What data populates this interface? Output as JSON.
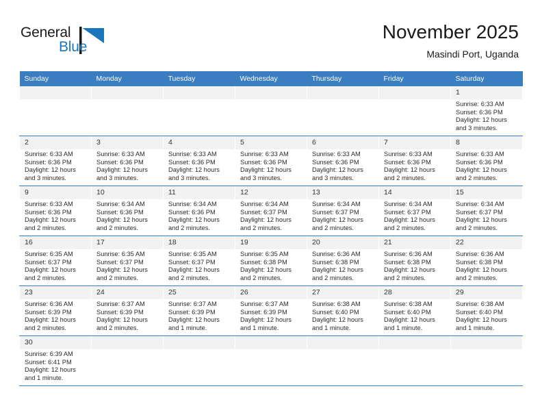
{
  "brand": {
    "name_part1": "General",
    "name_part2": "Blue",
    "logo_icon": "flag-triangle-icon",
    "color_blue": "#1b75bb",
    "color_black": "#1a1a1a"
  },
  "header": {
    "title": "November 2025",
    "subtitle": "Masindi Port, Uganda"
  },
  "theme": {
    "header_bg": "#3a7dc0",
    "daynum_bg": "#f2f2f2",
    "grid_line": "#3a7dc0"
  },
  "calendar": {
    "weekday_headers": [
      "Sunday",
      "Monday",
      "Tuesday",
      "Wednesday",
      "Thursday",
      "Friday",
      "Saturday"
    ],
    "weeks": [
      [
        {
          "empty": true
        },
        {
          "empty": true
        },
        {
          "empty": true
        },
        {
          "empty": true
        },
        {
          "empty": true
        },
        {
          "empty": true
        },
        {
          "day": "1",
          "sunrise": "Sunrise: 6:33 AM",
          "sunset": "Sunset: 6:36 PM",
          "daylight1": "Daylight: 12 hours",
          "daylight2": "and 3 minutes."
        }
      ],
      [
        {
          "day": "2",
          "sunrise": "Sunrise: 6:33 AM",
          "sunset": "Sunset: 6:36 PM",
          "daylight1": "Daylight: 12 hours",
          "daylight2": "and 3 minutes."
        },
        {
          "day": "3",
          "sunrise": "Sunrise: 6:33 AM",
          "sunset": "Sunset: 6:36 PM",
          "daylight1": "Daylight: 12 hours",
          "daylight2": "and 3 minutes."
        },
        {
          "day": "4",
          "sunrise": "Sunrise: 6:33 AM",
          "sunset": "Sunset: 6:36 PM",
          "daylight1": "Daylight: 12 hours",
          "daylight2": "and 3 minutes."
        },
        {
          "day": "5",
          "sunrise": "Sunrise: 6:33 AM",
          "sunset": "Sunset: 6:36 PM",
          "daylight1": "Daylight: 12 hours",
          "daylight2": "and 3 minutes."
        },
        {
          "day": "6",
          "sunrise": "Sunrise: 6:33 AM",
          "sunset": "Sunset: 6:36 PM",
          "daylight1": "Daylight: 12 hours",
          "daylight2": "and 3 minutes."
        },
        {
          "day": "7",
          "sunrise": "Sunrise: 6:33 AM",
          "sunset": "Sunset: 6:36 PM",
          "daylight1": "Daylight: 12 hours",
          "daylight2": "and 2 minutes."
        },
        {
          "day": "8",
          "sunrise": "Sunrise: 6:33 AM",
          "sunset": "Sunset: 6:36 PM",
          "daylight1": "Daylight: 12 hours",
          "daylight2": "and 2 minutes."
        }
      ],
      [
        {
          "day": "9",
          "sunrise": "Sunrise: 6:33 AM",
          "sunset": "Sunset: 6:36 PM",
          "daylight1": "Daylight: 12 hours",
          "daylight2": "and 2 minutes."
        },
        {
          "day": "10",
          "sunrise": "Sunrise: 6:34 AM",
          "sunset": "Sunset: 6:36 PM",
          "daylight1": "Daylight: 12 hours",
          "daylight2": "and 2 minutes."
        },
        {
          "day": "11",
          "sunrise": "Sunrise: 6:34 AM",
          "sunset": "Sunset: 6:36 PM",
          "daylight1": "Daylight: 12 hours",
          "daylight2": "and 2 minutes."
        },
        {
          "day": "12",
          "sunrise": "Sunrise: 6:34 AM",
          "sunset": "Sunset: 6:37 PM",
          "daylight1": "Daylight: 12 hours",
          "daylight2": "and 2 minutes."
        },
        {
          "day": "13",
          "sunrise": "Sunrise: 6:34 AM",
          "sunset": "Sunset: 6:37 PM",
          "daylight1": "Daylight: 12 hours",
          "daylight2": "and 2 minutes."
        },
        {
          "day": "14",
          "sunrise": "Sunrise: 6:34 AM",
          "sunset": "Sunset: 6:37 PM",
          "daylight1": "Daylight: 12 hours",
          "daylight2": "and 2 minutes."
        },
        {
          "day": "15",
          "sunrise": "Sunrise: 6:34 AM",
          "sunset": "Sunset: 6:37 PM",
          "daylight1": "Daylight: 12 hours",
          "daylight2": "and 2 minutes."
        }
      ],
      [
        {
          "day": "16",
          "sunrise": "Sunrise: 6:35 AM",
          "sunset": "Sunset: 6:37 PM",
          "daylight1": "Daylight: 12 hours",
          "daylight2": "and 2 minutes."
        },
        {
          "day": "17",
          "sunrise": "Sunrise: 6:35 AM",
          "sunset": "Sunset: 6:37 PM",
          "daylight1": "Daylight: 12 hours",
          "daylight2": "and 2 minutes."
        },
        {
          "day": "18",
          "sunrise": "Sunrise: 6:35 AM",
          "sunset": "Sunset: 6:37 PM",
          "daylight1": "Daylight: 12 hours",
          "daylight2": "and 2 minutes."
        },
        {
          "day": "19",
          "sunrise": "Sunrise: 6:35 AM",
          "sunset": "Sunset: 6:38 PM",
          "daylight1": "Daylight: 12 hours",
          "daylight2": "and 2 minutes."
        },
        {
          "day": "20",
          "sunrise": "Sunrise: 6:36 AM",
          "sunset": "Sunset: 6:38 PM",
          "daylight1": "Daylight: 12 hours",
          "daylight2": "and 2 minutes."
        },
        {
          "day": "21",
          "sunrise": "Sunrise: 6:36 AM",
          "sunset": "Sunset: 6:38 PM",
          "daylight1": "Daylight: 12 hours",
          "daylight2": "and 2 minutes."
        },
        {
          "day": "22",
          "sunrise": "Sunrise: 6:36 AM",
          "sunset": "Sunset: 6:38 PM",
          "daylight1": "Daylight: 12 hours",
          "daylight2": "and 2 minutes."
        }
      ],
      [
        {
          "day": "23",
          "sunrise": "Sunrise: 6:36 AM",
          "sunset": "Sunset: 6:39 PM",
          "daylight1": "Daylight: 12 hours",
          "daylight2": "and 2 minutes."
        },
        {
          "day": "24",
          "sunrise": "Sunrise: 6:37 AM",
          "sunset": "Sunset: 6:39 PM",
          "daylight1": "Daylight: 12 hours",
          "daylight2": "and 2 minutes."
        },
        {
          "day": "25",
          "sunrise": "Sunrise: 6:37 AM",
          "sunset": "Sunset: 6:39 PM",
          "daylight1": "Daylight: 12 hours",
          "daylight2": "and 1 minute."
        },
        {
          "day": "26",
          "sunrise": "Sunrise: 6:37 AM",
          "sunset": "Sunset: 6:39 PM",
          "daylight1": "Daylight: 12 hours",
          "daylight2": "and 1 minute."
        },
        {
          "day": "27",
          "sunrise": "Sunrise: 6:38 AM",
          "sunset": "Sunset: 6:40 PM",
          "daylight1": "Daylight: 12 hours",
          "daylight2": "and 1 minute."
        },
        {
          "day": "28",
          "sunrise": "Sunrise: 6:38 AM",
          "sunset": "Sunset: 6:40 PM",
          "daylight1": "Daylight: 12 hours",
          "daylight2": "and 1 minute."
        },
        {
          "day": "29",
          "sunrise": "Sunrise: 6:38 AM",
          "sunset": "Sunset: 6:40 PM",
          "daylight1": "Daylight: 12 hours",
          "daylight2": "and 1 minute."
        }
      ],
      [
        {
          "day": "30",
          "sunrise": "Sunrise: 6:39 AM",
          "sunset": "Sunset: 6:41 PM",
          "daylight1": "Daylight: 12 hours",
          "daylight2": "and 1 minute."
        },
        {
          "empty": true
        },
        {
          "empty": true
        },
        {
          "empty": true
        },
        {
          "empty": true
        },
        {
          "empty": true
        },
        {
          "empty": true
        }
      ]
    ]
  }
}
